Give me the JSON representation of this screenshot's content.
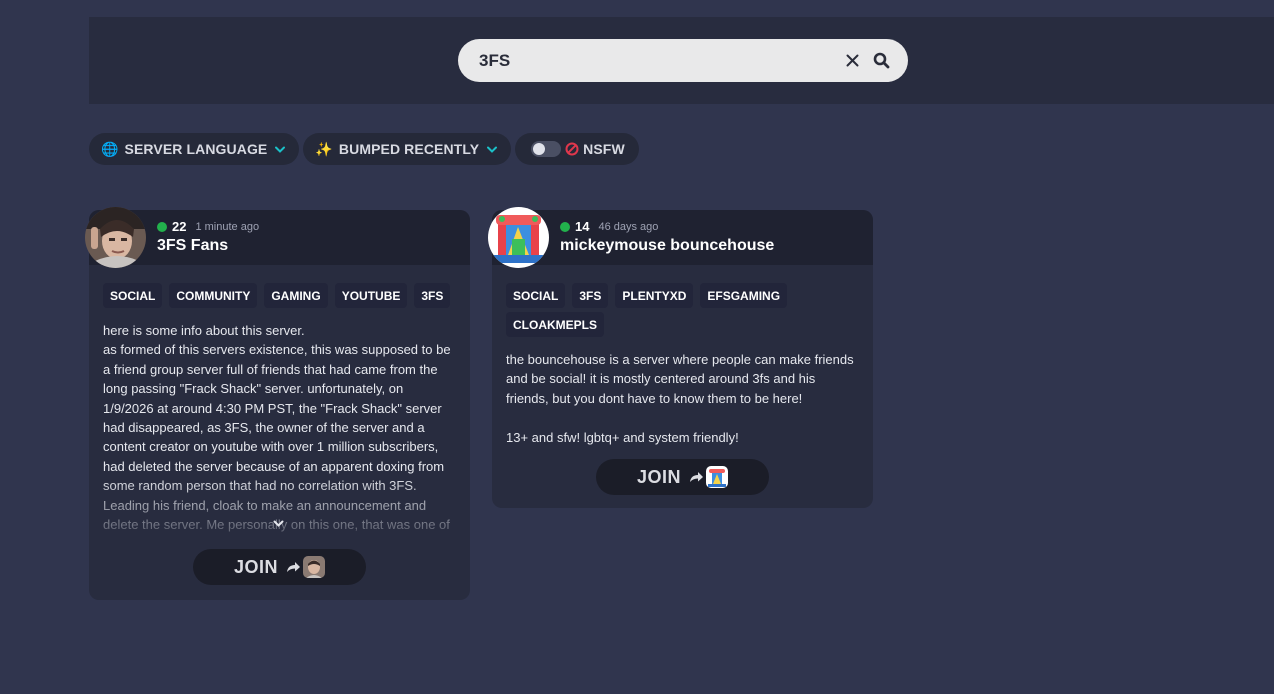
{
  "search": {
    "value": "3FS",
    "placeholder": ""
  },
  "filters": [
    {
      "emoji": "🌐",
      "label": "SERVER LANGUAGE"
    },
    {
      "emoji": "✨",
      "label": "BUMPED RECENTLY"
    },
    {
      "label": "NSFW",
      "enabled": false
    }
  ],
  "servers": [
    {
      "online": "22",
      "bumped": "1 minute ago",
      "name": "3FS Fans",
      "tags": [
        "SOCIAL",
        "COMMUNITY",
        "GAMING",
        "YOUTUBE",
        "3FS"
      ],
      "description": "here is some info about this server.\nas formed of this servers existence, this was supposed to be a friend group server full of friends that had came from the long passing \"Frack Shack\" server. unfortunately, on 1/9/2026 at around 4:30 PM PST, the \"Frack Shack\" server had disappeared, as 3FS, the owner of the server and a content creator on youtube with over 1 million subscribers, had deleted the server because of an apparent doxing from some random person that had no correlation with 3FS. Leading his friend, cloak to make an announcement and delete the server. Me personally on this one, that was one of",
      "join_label": "JOIN"
    },
    {
      "online": "14",
      "bumped": "46 days ago",
      "name": "mickeymouse bouncehouse",
      "tags": [
        "SOCIAL",
        "3FS",
        "PLENTYXD",
        "EFSGAMING",
        "CLOAKMEPLS"
      ],
      "description": "the bouncehouse is a server where people can make friends and be social! it is mostly centered around 3fs and his friends, but you dont have to know them to be here!\n\n13+ and sfw! lgbtq+ and system friendly!",
      "join_label": "JOIN"
    }
  ],
  "colors": {
    "page_bg": "#30354e",
    "card_bg": "#282c3f",
    "online": "#22b14c",
    "accent": "#1bc1c8",
    "nsfw": "#e0374c"
  }
}
